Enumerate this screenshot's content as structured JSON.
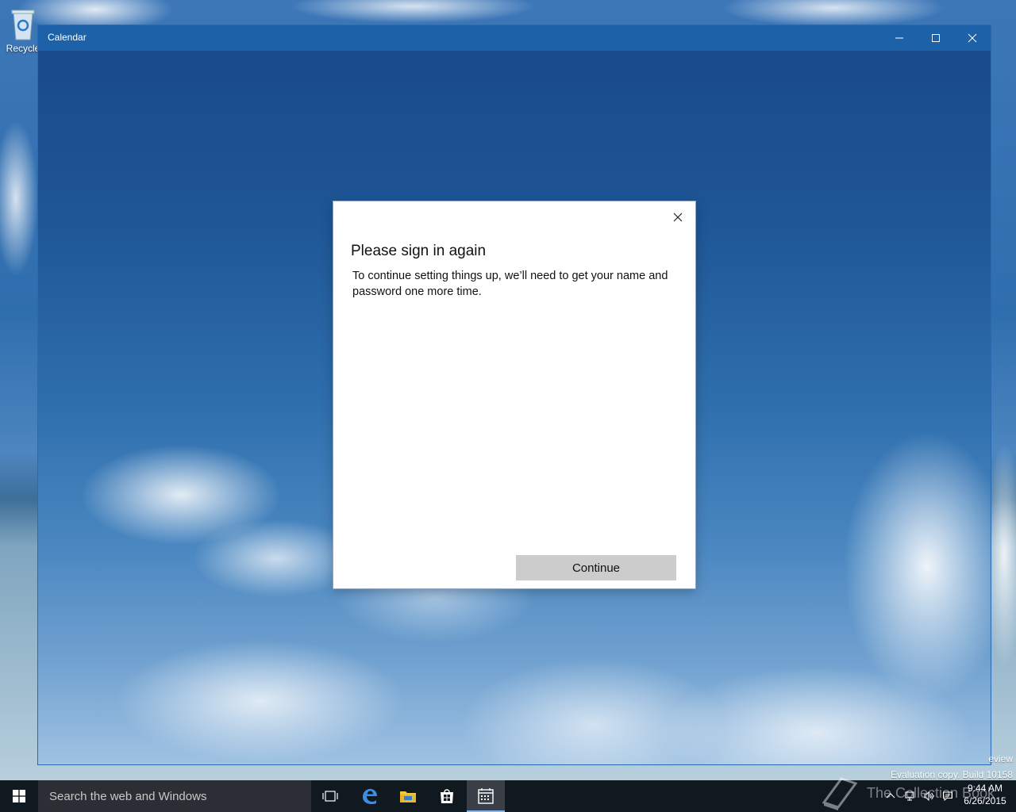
{
  "desktop": {
    "recycle_bin_label": "Recycle",
    "watermark_preview": "eview",
    "watermark_build": "Evaluation copy. Build 10158"
  },
  "window": {
    "title": "Calendar"
  },
  "dialog": {
    "title": "Please sign in again",
    "message": "To continue setting things up, we’ll need to get your name and password one more time.",
    "continue_label": "Continue"
  },
  "taskbar": {
    "search_placeholder": "Search the web and Windows",
    "clock_time": "9:44 AM",
    "clock_date": "6/26/2015",
    "brand_text": "The Collection Book"
  },
  "colors": {
    "titlebar": "#1d61a8",
    "taskbar": "#101820",
    "accent": "#7eb4ea"
  }
}
